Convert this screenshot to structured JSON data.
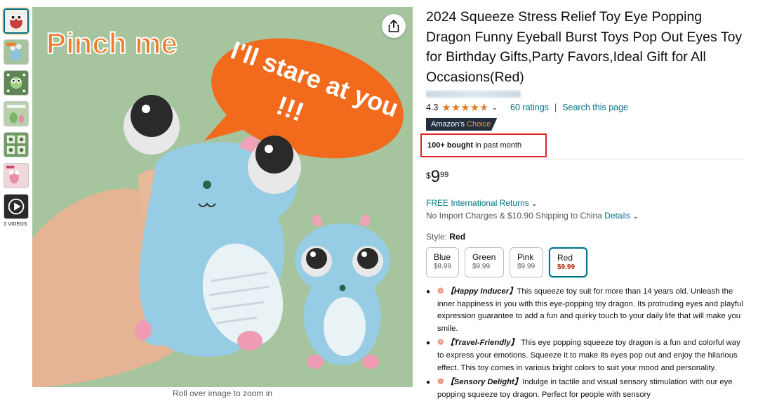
{
  "thumbnails": {
    "items": [
      {
        "name": "thumb-dragon-red",
        "color": "#c94040"
      },
      {
        "name": "thumb-dragon-blue-squeeze",
        "color": "#7fb4c8"
      },
      {
        "name": "thumb-dragon-green-eyes",
        "color": "#6b8f5a"
      },
      {
        "name": "thumb-dragon-size",
        "color": "#a4c09a"
      },
      {
        "name": "thumb-dragon-grid",
        "color": "#6f9a62"
      },
      {
        "name": "thumb-dragon-pink",
        "color": "#e8a7b5"
      }
    ],
    "videos_label": "3 VIDEOS"
  },
  "main_image": {
    "caption_pinch": "Pinch me",
    "speech_line1": "I'll stare at you",
    "speech_line2": "!!!",
    "zoom_hint": "Roll over image to zoom in"
  },
  "product": {
    "title": "2024 Squeeze Stress Relief Toy Eye Popping Dragon Funny Eyeball Burst Toys Pop Out Eyes Toy for Birthday Gifts,Party Favors,Ideal Gift for All Occasions(Red)",
    "rating_value": "4.3",
    "ratings_link": "60 ratings",
    "search_link": "Search this page",
    "badge_prefix": "Amazon's",
    "badge_accent": "Choice",
    "bought_bold": "100+ bought",
    "bought_rest": "in past month",
    "price_symbol": "$",
    "price_whole": "9",
    "price_fraction": "99",
    "returns_text": "FREE International Returns",
    "shipping_text": "No Import Charges & $10.90 Shipping to China",
    "shipping_details": "Details",
    "style_label": "Style:",
    "style_value": "Red"
  },
  "swatches": [
    {
      "name": "Blue",
      "price": "$9.99"
    },
    {
      "name": "Green",
      "price": "$9.99"
    },
    {
      "name": "Pink",
      "price": "$9.99"
    },
    {
      "name": "Red",
      "price": "$9.99"
    }
  ],
  "bullets": [
    {
      "head": "【Happy Inducer】",
      "text": "This squeeze toy suit for more than 14 years old. Unleash the inner happiness in you with this eye-popping toy dragon. Its protruding eyes and playful expression guarantee to add a fun and quirky touch to your daily life that will make you smile."
    },
    {
      "head": "【Travel-Friendly】",
      "text": " This eye popping squeeze toy dragon is a fun and colorful way to express your emotions. Squeeze it to make its eyes pop out and enjoy the hilarious effect. This toy comes in various bright colors to suit your mood and personality."
    },
    {
      "head": "【Sensory Delight】",
      "text": "Indulge in tactile and visual sensory stimulation with our eye popping squeeze toy dragon. Perfect for people with sensory"
    }
  ],
  "colors": {
    "link": "#007185",
    "star": "#de7921",
    "highlight_box": "#e0262a",
    "badge_bg": "#232f3e",
    "badge_accent": "#f69931",
    "image_bg": "#a6c59f",
    "speech_bubble": "#f26a1b"
  }
}
